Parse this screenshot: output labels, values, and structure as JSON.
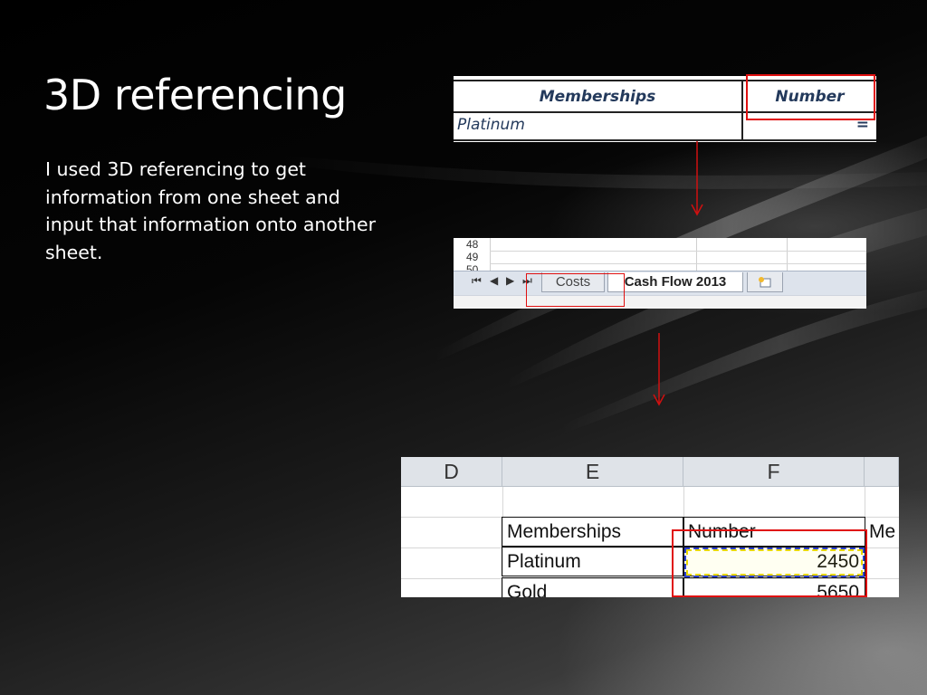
{
  "slide": {
    "title": "3D referencing",
    "body": "I used 3D referencing to get information from one sheet and input that information onto another sheet."
  },
  "screenshot_top": {
    "header": [
      "Memberships",
      "Number"
    ],
    "row": [
      "Platinum",
      "="
    ]
  },
  "screenshot_tabs": {
    "row_numbers": [
      "48",
      "49",
      "50"
    ],
    "nav_icons": [
      "first-sheet-icon",
      "prev-sheet-icon",
      "next-sheet-icon",
      "last-sheet-icon"
    ],
    "tabs": [
      "Costs",
      "Cash Flow 2013"
    ],
    "active_tab": "Cash Flow 2013",
    "new_sheet_icon": "insert-worksheet-icon"
  },
  "screenshot_bottom": {
    "columns": [
      "D",
      "E",
      "F",
      ""
    ],
    "header": [
      "Memberships",
      "Number",
      "Me"
    ],
    "rows": [
      [
        "Platinum",
        "2450"
      ],
      [
        "Gold",
        "5650"
      ]
    ]
  },
  "colors": {
    "highlight": "#e01010",
    "arrow": "#d01010",
    "marquee": "#2b3fd0"
  }
}
